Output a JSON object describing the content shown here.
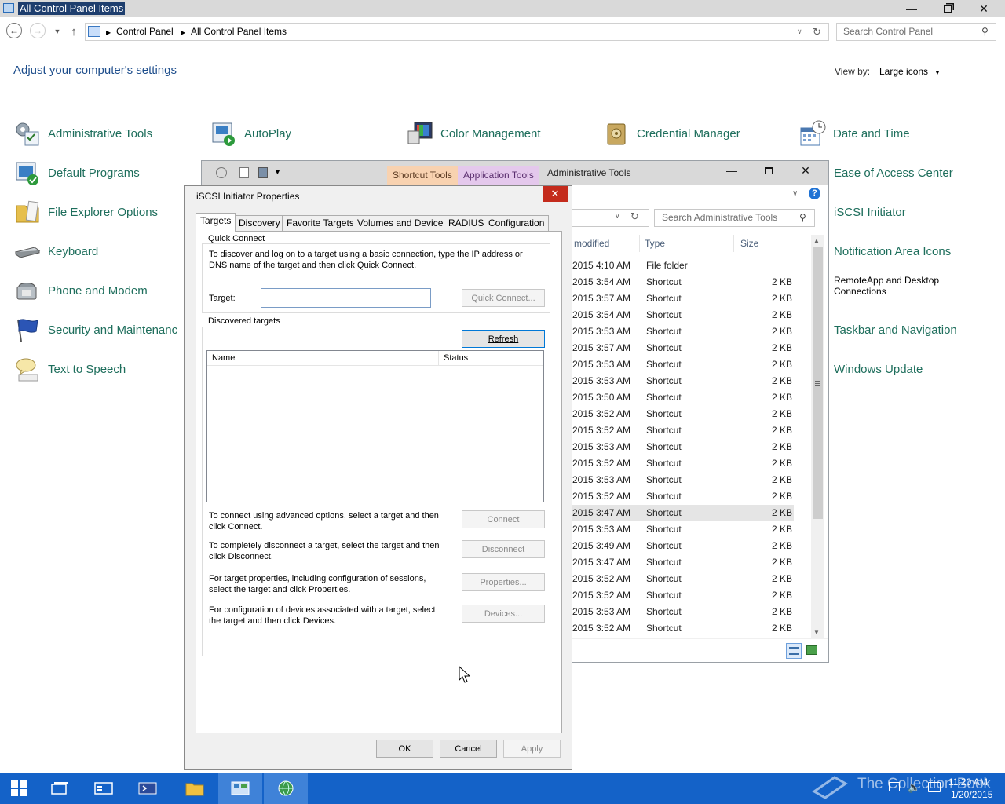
{
  "window": {
    "title": "All Control Panel Items",
    "breadcrumb": [
      "Control Panel",
      "All Control Panel Items"
    ],
    "search_placeholder": "Search Control Panel"
  },
  "control_panel": {
    "heading": "Adjust your computer's settings",
    "view_by_label": "View by:",
    "view_by_value": "Large icons",
    "items": [
      {
        "label": "Administrative Tools",
        "icon": "admin-tools-icon"
      },
      {
        "label": "AutoPlay",
        "icon": "autoplay-icon"
      },
      {
        "label": "Color Management",
        "icon": "color-management-icon"
      },
      {
        "label": "Credential Manager",
        "icon": "credential-manager-icon"
      },
      {
        "label": "Date and Time",
        "icon": "calendar-clock-icon"
      },
      {
        "label": "Default Programs",
        "icon": "default-programs-icon"
      },
      {
        "label": "Ease of Access Center",
        "icon": "ease-of-access-icon"
      },
      {
        "label": "File Explorer Options",
        "icon": "folder-options-icon"
      },
      {
        "label": "iSCSI Initiator",
        "icon": "iscsi-icon"
      },
      {
        "label": "Keyboard",
        "icon": "keyboard-icon"
      },
      {
        "label": "Notification Area Icons",
        "icon": "notification-area-icon"
      },
      {
        "label": "Phone and Modem",
        "icon": "phone-modem-icon"
      },
      {
        "label": "RemoteApp and Desktop Connections",
        "icon": "remoteapp-icon"
      },
      {
        "label": "Security and Maintenanc",
        "icon": "security-flag-icon"
      },
      {
        "label": "Taskbar and Navigation",
        "icon": "taskbar-icon"
      },
      {
        "label": "Text to Speech",
        "icon": "speech-bubble-icon"
      },
      {
        "label": "Windows Update",
        "icon": "windows-update-icon"
      }
    ],
    "right_items": {
      "ease": "Ease of Access Center",
      "iscsi": "iSCSI Initiator",
      "notification": "Notification Area Icons",
      "remote_line1": "RemoteApp and Desktop",
      "remote_line2": "Connections",
      "taskbar": "Taskbar and Navigation",
      "update": "Windows Update"
    }
  },
  "admin_window": {
    "title": "Administrative Tools",
    "ribbon_tab_shortcut": "Shortcut Tools",
    "ribbon_tab_app": "Application Tools",
    "search_placeholder": "Search Administrative Tools",
    "columns": {
      "modified": "modified",
      "type": "Type",
      "size": "Size"
    },
    "rows": [
      {
        "date": "2015 4:10 AM",
        "type": "File folder",
        "size": ""
      },
      {
        "date": "2015 3:54 AM",
        "type": "Shortcut",
        "size": "2 KB"
      },
      {
        "date": "2015 3:57 AM",
        "type": "Shortcut",
        "size": "2 KB"
      },
      {
        "date": "2015 3:54 AM",
        "type": "Shortcut",
        "size": "2 KB"
      },
      {
        "date": "2015 3:53 AM",
        "type": "Shortcut",
        "size": "2 KB"
      },
      {
        "date": "2015 3:57 AM",
        "type": "Shortcut",
        "size": "2 KB"
      },
      {
        "date": "2015 3:53 AM",
        "type": "Shortcut",
        "size": "2 KB"
      },
      {
        "date": "2015 3:53 AM",
        "type": "Shortcut",
        "size": "2 KB"
      },
      {
        "date": "2015 3:50 AM",
        "type": "Shortcut",
        "size": "2 KB"
      },
      {
        "date": "2015 3:52 AM",
        "type": "Shortcut",
        "size": "2 KB"
      },
      {
        "date": "2015 3:52 AM",
        "type": "Shortcut",
        "size": "2 KB"
      },
      {
        "date": "2015 3:53 AM",
        "type": "Shortcut",
        "size": "2 KB"
      },
      {
        "date": "2015 3:52 AM",
        "type": "Shortcut",
        "size": "2 KB"
      },
      {
        "date": "2015 3:53 AM",
        "type": "Shortcut",
        "size": "2 KB"
      },
      {
        "date": "2015 3:52 AM",
        "type": "Shortcut",
        "size": "2 KB"
      },
      {
        "date": "2015 3:47 AM",
        "type": "Shortcut",
        "size": "2 KB",
        "selected": true
      },
      {
        "date": "2015 3:53 AM",
        "type": "Shortcut",
        "size": "2 KB"
      },
      {
        "date": "2015 3:49 AM",
        "type": "Shortcut",
        "size": "2 KB"
      },
      {
        "date": "2015 3:47 AM",
        "type": "Shortcut",
        "size": "2 KB"
      },
      {
        "date": "2015 3:52 AM",
        "type": "Shortcut",
        "size": "2 KB"
      },
      {
        "date": "2015 3:52 AM",
        "type": "Shortcut",
        "size": "2 KB"
      },
      {
        "date": "2015 3:53 AM",
        "type": "Shortcut",
        "size": "2 KB"
      },
      {
        "date": "2015 3:52 AM",
        "type": "Shortcut",
        "size": "2 KB"
      }
    ]
  },
  "iscsi_dialog": {
    "title": "iSCSI Initiator Properties",
    "tabs": [
      "Targets",
      "Discovery",
      "Favorite Targets",
      "Volumes and Devices",
      "RADIUS",
      "Configuration"
    ],
    "active_tab": "Targets",
    "quick_connect": {
      "caption": "Quick Connect",
      "description_line1": "To discover and log on to a target using a basic connection, type the IP address or",
      "description_line2": "DNS name of the target and then click Quick Connect.",
      "target_label": "Target:",
      "target_value": "",
      "button": "Quick Connect..."
    },
    "discovered": {
      "caption": "Discovered targets",
      "refresh_button": "Refresh",
      "columns": [
        "Name",
        "Status"
      ]
    },
    "actions": [
      {
        "line1": "To connect using advanced options, select a target and then",
        "line2": "click Connect.",
        "button": "Connect"
      },
      {
        "line1": "To completely disconnect a target, select the target and then",
        "line2": "click Disconnect.",
        "button": "Disconnect"
      },
      {
        "line1": "For target properties, including configuration of sessions,",
        "line2": "select the target and click Properties.",
        "button": "Properties..."
      },
      {
        "line1": "For configuration of devices associated with a target, select",
        "line2": "the target and then click Devices.",
        "button": "Devices..."
      }
    ],
    "ok_button": "OK",
    "cancel_button": "Cancel",
    "apply_button": "Apply"
  },
  "taskbar": {
    "time": "11:20 AM",
    "date": "1/20/2015",
    "watermark": "The Collection Book"
  },
  "colors": {
    "taskbar": "#1462c8",
    "link": "#1e6e5c",
    "heading": "#1e4e8c",
    "close_red": "#c42b1c"
  }
}
